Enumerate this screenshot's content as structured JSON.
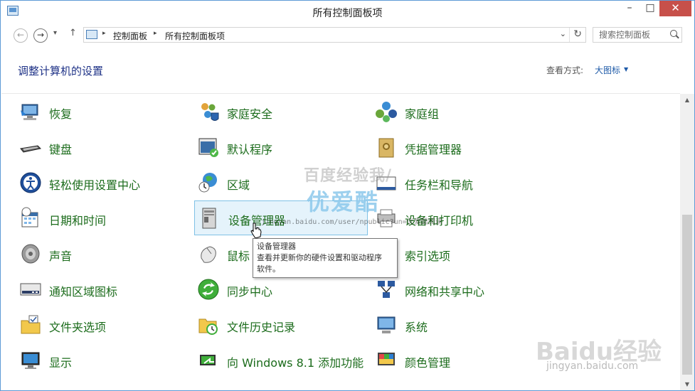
{
  "window": {
    "title": "所有控制面板项",
    "min_label": "–",
    "max_label": "□",
    "close_label": "✕"
  },
  "nav": {
    "back_label": "←",
    "forward_label": "→",
    "recent_label": "▾",
    "up_label": "↑",
    "breadcrumb": [
      "控制面板",
      "所有控制面板项"
    ],
    "crumb_sep": "▸",
    "dropdown_label": "⌄",
    "refresh_label": "↻",
    "search_placeholder": "搜索控制面板"
  },
  "header": {
    "title": "调整计算机的设置",
    "view_by_label": "查看方式:",
    "view_by_value": "大图标"
  },
  "items": [
    {
      "label": "恢复",
      "icon": "recovery-icon"
    },
    {
      "label": "家庭安全",
      "icon": "family-safety-icon"
    },
    {
      "label": "家庭组",
      "icon": "homegroup-icon"
    },
    {
      "label": "键盘",
      "icon": "keyboard-icon"
    },
    {
      "label": "默认程序",
      "icon": "default-programs-icon"
    },
    {
      "label": "凭据管理器",
      "icon": "credential-manager-icon"
    },
    {
      "label": "轻松使用设置中心",
      "icon": "ease-of-access-icon"
    },
    {
      "label": "区域",
      "icon": "region-icon"
    },
    {
      "label": "任务栏和导航",
      "icon": "taskbar-icon"
    },
    {
      "label": "日期和时间",
      "icon": "date-time-icon"
    },
    {
      "label": "设备管理器",
      "icon": "device-manager-icon"
    },
    {
      "label": "设备和打印机",
      "icon": "devices-printers-icon"
    },
    {
      "label": "声音",
      "icon": "sound-icon"
    },
    {
      "label": "鼠标",
      "icon": "mouse-icon"
    },
    {
      "label": "索引选项",
      "icon": "indexing-icon"
    },
    {
      "label": "通知区域图标",
      "icon": "notification-icons-icon"
    },
    {
      "label": "同步中心",
      "icon": "sync-center-icon"
    },
    {
      "label": "网络和共享中心",
      "icon": "network-icon"
    },
    {
      "label": "文件夹选项",
      "icon": "folder-options-icon"
    },
    {
      "label": "文件历史记录",
      "icon": "file-history-icon"
    },
    {
      "label": "系统",
      "icon": "system-icon"
    },
    {
      "label": "显示",
      "icon": "display-icon"
    },
    {
      "label": "向 Windows 8.1 添加功能",
      "icon": "add-features-icon"
    },
    {
      "label": "颜色管理",
      "icon": "color-management-icon"
    }
  ],
  "tooltip": {
    "title": "设备管理器",
    "desc1": "查看并更新你的硬件设置和驱动程序",
    "desc2": "软件。"
  },
  "watermark": {
    "line1": "百度经验我/",
    "line2": "优爱酷",
    "url": "jingyan.baidu.com/user/npublic?un=优爱酷阅读",
    "logo": "Baidu经验",
    "logo_url": "jingyan.baidu.com"
  },
  "colors": {
    "link_green": "#1c6c1c",
    "heading_blue": "#1e3287",
    "close_red": "#c7504a",
    "hover_bg": "#e5f3fb"
  }
}
